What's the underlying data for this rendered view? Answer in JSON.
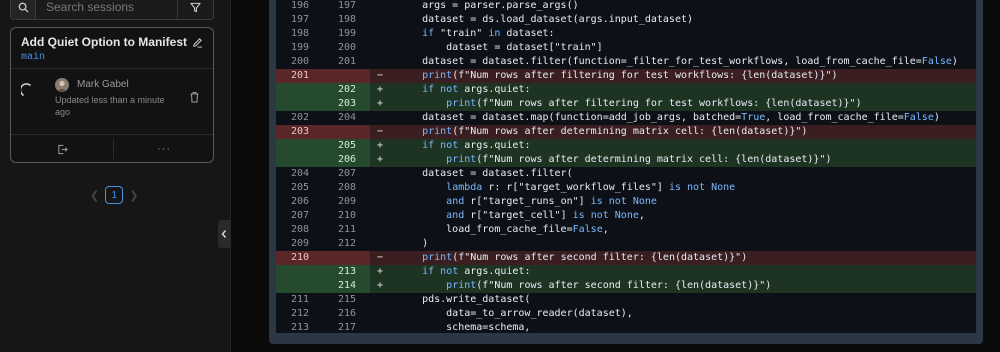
{
  "sidebar": {
    "search_placeholder": "Search sessions",
    "card": {
      "title": "Add Quiet Option to Manifest",
      "branch": "main",
      "author": "Mark Gabel",
      "updated": "Updated less than a minute ago",
      "more": "···"
    },
    "pagination": {
      "current_page": "1"
    }
  },
  "diff": {
    "lines": [
      {
        "old": "196",
        "new": "197",
        "mark": "",
        "type": "ctx",
        "text": "    args = parser.parse_args()"
      },
      {
        "old": "197",
        "new": "198",
        "mark": "",
        "type": "ctx",
        "text": "    dataset = ds.load_dataset(args.input_dataset)"
      },
      {
        "old": "198",
        "new": "199",
        "mark": "",
        "type": "ctx",
        "text": "    if \"train\" in dataset:"
      },
      {
        "old": "199",
        "new": "200",
        "mark": "",
        "type": "ctx",
        "text": "        dataset = dataset[\"train\"]"
      },
      {
        "old": "200",
        "new": "201",
        "mark": "",
        "type": "ctx",
        "text": "    dataset = dataset.filter(function=_filter_for_test_workflows, load_from_cache_file=False)"
      },
      {
        "old": "201",
        "new": "",
        "mark": "−",
        "type": "del",
        "text": "    print(f\"Num rows after filtering for test workflows: {len(dataset)}\")"
      },
      {
        "old": "",
        "new": "202",
        "mark": "+",
        "type": "add",
        "text": "    if not args.quiet:"
      },
      {
        "old": "",
        "new": "203",
        "mark": "+",
        "type": "add",
        "text": "        print(f\"Num rows after filtering for test workflows: {len(dataset)}\")"
      },
      {
        "old": "202",
        "new": "204",
        "mark": "",
        "type": "ctx",
        "text": "    dataset = dataset.map(function=add_job_args, batched=True, load_from_cache_file=False)"
      },
      {
        "old": "203",
        "new": "",
        "mark": "−",
        "type": "del",
        "text": "    print(f\"Num rows after determining matrix cell: {len(dataset)}\")"
      },
      {
        "old": "",
        "new": "205",
        "mark": "+",
        "type": "add",
        "text": "    if not args.quiet:"
      },
      {
        "old": "",
        "new": "206",
        "mark": "+",
        "type": "add",
        "text": "        print(f\"Num rows after determining matrix cell: {len(dataset)}\")"
      },
      {
        "old": "204",
        "new": "207",
        "mark": "",
        "type": "ctx",
        "text": "    dataset = dataset.filter("
      },
      {
        "old": "205",
        "new": "208",
        "mark": "",
        "type": "ctx",
        "text": "        lambda r: r[\"target_workflow_files\"] is not None"
      },
      {
        "old": "206",
        "new": "209",
        "mark": "",
        "type": "ctx",
        "text": "        and r[\"target_runs_on\"] is not None"
      },
      {
        "old": "207",
        "new": "210",
        "mark": "",
        "type": "ctx",
        "text": "        and r[\"target_cell\"] is not None,"
      },
      {
        "old": "208",
        "new": "211",
        "mark": "",
        "type": "ctx",
        "text": "        load_from_cache_file=False,"
      },
      {
        "old": "209",
        "new": "212",
        "mark": "",
        "type": "ctx",
        "text": "    )"
      },
      {
        "old": "210",
        "new": "",
        "mark": "−",
        "type": "del",
        "text": "    print(f\"Num rows after second filter: {len(dataset)}\")"
      },
      {
        "old": "",
        "new": "213",
        "mark": "+",
        "type": "add",
        "text": "    if not args.quiet:"
      },
      {
        "old": "",
        "new": "214",
        "mark": "+",
        "type": "add",
        "text": "        print(f\"Num rows after second filter: {len(dataset)}\")"
      },
      {
        "old": "211",
        "new": "215",
        "mark": "",
        "type": "ctx",
        "text": "    pds.write_dataset("
      },
      {
        "old": "212",
        "new": "216",
        "mark": "",
        "type": "ctx",
        "text": "        data=_to_arrow_reader(dataset),"
      },
      {
        "old": "213",
        "new": "217",
        "mark": "",
        "type": "ctx",
        "text": "        schema=schema,"
      }
    ]
  },
  "colors": {
    "accent": "#4a8fe0",
    "deleted_bg": "#3a1e20",
    "added_bg": "#1e3423"
  },
  "icons": [
    "search-icon",
    "filter-icon",
    "pencil-icon",
    "spinner-icon",
    "trash-icon",
    "exit-icon",
    "chevron-left-icon",
    "chevron-right-icon",
    "collapse-chevron-icon"
  ]
}
